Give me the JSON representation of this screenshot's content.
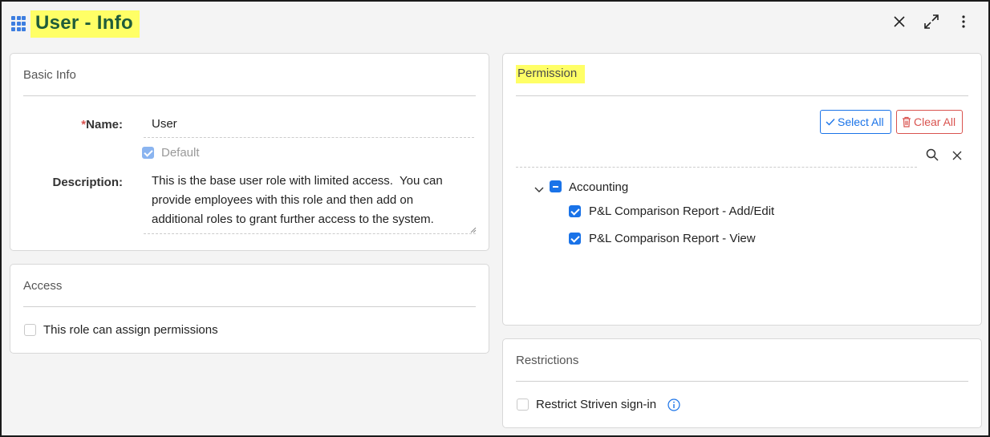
{
  "header": {
    "title": "User - Info"
  },
  "window_icons": [
    "close-icon",
    "expand-icon",
    "more-vertical-icon"
  ],
  "basic_info": {
    "title": "Basic Info",
    "name_label": "Name:",
    "name_required": "*",
    "name_value": "User",
    "default_label": "Default",
    "default_checked": true,
    "description_label": "Description:",
    "description_value": "This is the base user role with limited access.  You can provide employees with this role and then add on additional roles to grant further access to the system."
  },
  "access": {
    "title": "Access",
    "assign_label": "This role can assign permissions",
    "assign_checked": false
  },
  "permission": {
    "title": "Permission",
    "select_all": "Select All",
    "clear_all": "Clear All",
    "search_placeholder": "",
    "tree": {
      "group": "Accounting",
      "items": [
        {
          "label": "P&L Comparison Report - Add/Edit",
          "checked": true
        },
        {
          "label": "P&L Comparison Report - View",
          "checked": true
        }
      ]
    }
  },
  "restrictions": {
    "title": "Restrictions",
    "restrict_label": "Restrict Striven sign-in",
    "restrict_checked": false
  },
  "colors": {
    "accent": "#1a73e8",
    "danger": "#d9534f",
    "highlight": "#ffff66",
    "title_text": "#1f5c3a"
  }
}
